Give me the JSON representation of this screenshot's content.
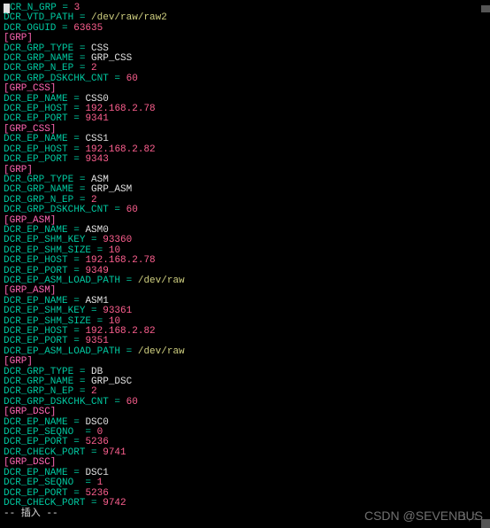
{
  "lines": [
    {
      "cursor": true,
      "key": "CR_N_GRP",
      "op": "=",
      "val": "3",
      "valClass": "num"
    },
    {
      "key": "DCR_VTD_PATH",
      "op": "=",
      "val": "/dev/raw/raw2",
      "valClass": "str-yellow"
    },
    {
      "key": "DCR_OGUID",
      "op": "=",
      "val": "63635",
      "valClass": "num"
    },
    {
      "section": "[GRP]"
    },
    {
      "key": "DCR_GRP_TYPE",
      "op": "=",
      "val": "CSS",
      "valClass": "val-white"
    },
    {
      "key": "DCR_GRP_NAME",
      "op": "=",
      "val": "GRP_CSS",
      "valClass": "val-white"
    },
    {
      "key": "DCR_GRP_N_EP",
      "op": "=",
      "val": "2",
      "valClass": "num"
    },
    {
      "key": "DCR_GRP_DSKCHK_CNT",
      "op": "=",
      "val": "60",
      "valClass": "num"
    },
    {
      "section": "[GRP_CSS]"
    },
    {
      "key": "DCR_EP_NAME",
      "op": "=",
      "val": "CSS0",
      "valClass": "val-white"
    },
    {
      "key": "DCR_EP_HOST",
      "op": "=",
      "val": "192.168.2.78",
      "valClass": "num"
    },
    {
      "key": "DCR_EP_PORT",
      "op": "=",
      "val": "9341",
      "valClass": "num"
    },
    {
      "section": "[GRP_CSS]"
    },
    {
      "key": "DCR_EP_NAME",
      "op": "=",
      "val": "CSS1",
      "valClass": "val-white"
    },
    {
      "key": "DCR_EP_HOST",
      "op": "=",
      "val": "192.168.2.82",
      "valClass": "num"
    },
    {
      "key": "DCR_EP_PORT",
      "op": "=",
      "val": "9343",
      "valClass": "num"
    },
    {
      "section": "[GRP]"
    },
    {
      "key": "DCR_GRP_TYPE",
      "op": "=",
      "val": "ASM",
      "valClass": "val-white"
    },
    {
      "key": "DCR_GRP_NAME",
      "op": "=",
      "val": "GRP_ASM",
      "valClass": "val-white"
    },
    {
      "key": "DCR_GRP_N_EP",
      "op": "=",
      "val": "2",
      "valClass": "num"
    },
    {
      "key": "DCR_GRP_DSKCHK_CNT",
      "op": "=",
      "val": "60",
      "valClass": "num"
    },
    {
      "section": "[GRP_ASM]"
    },
    {
      "key": "DCR_EP_NAME",
      "op": "=",
      "val": "ASM0",
      "valClass": "val-white"
    },
    {
      "key": "DCR_EP_SHM_KEY",
      "op": "=",
      "val": "93360",
      "valClass": "num"
    },
    {
      "key": "DCR_EP_SHM_SIZE",
      "op": "=",
      "val": "10",
      "valClass": "num"
    },
    {
      "key": "DCR_EP_HOST",
      "op": "=",
      "val": "192.168.2.78",
      "valClass": "num"
    },
    {
      "key": "DCR_EP_PORT",
      "op": "=",
      "val": "9349",
      "valClass": "num"
    },
    {
      "key": "DCR_EP_ASM_LOAD_PATH",
      "op": "=",
      "val": "/dev/raw",
      "valClass": "str-yellow"
    },
    {
      "section": "[GRP_ASM]"
    },
    {
      "key": "DCR_EP_NAME",
      "op": "=",
      "val": "ASM1",
      "valClass": "val-white"
    },
    {
      "key": "DCR_EP_SHM_KEY",
      "op": "=",
      "val": "93361",
      "valClass": "num"
    },
    {
      "key": "DCR_EP_SHM_SIZE",
      "op": "=",
      "val": "10",
      "valClass": "num"
    },
    {
      "key": "DCR_EP_HOST",
      "op": "=",
      "val": "192.168.2.82",
      "valClass": "num"
    },
    {
      "key": "DCR_EP_PORT",
      "op": "=",
      "val": "9351",
      "valClass": "num"
    },
    {
      "key": "DCR_EP_ASM_LOAD_PATH",
      "op": "=",
      "val": "/dev/raw",
      "valClass": "str-yellow"
    },
    {
      "section": "[GRP]"
    },
    {
      "key": "DCR_GRP_TYPE",
      "op": "=",
      "val": "DB",
      "valClass": "val-white"
    },
    {
      "key": "DCR_GRP_NAME",
      "op": "=",
      "val": "GRP_DSC",
      "valClass": "val-white"
    },
    {
      "key": "DCR_GRP_N_EP",
      "op": "=",
      "val": "2",
      "valClass": "num"
    },
    {
      "key": "DCR_GRP_DSKCHK_CNT",
      "op": "=",
      "val": "60",
      "valClass": "num"
    },
    {
      "section": "[GRP_DSC]"
    },
    {
      "key": "DCR_EP_NAME",
      "op": "=",
      "val": "DSC0",
      "valClass": "val-white"
    },
    {
      "key": "DCR_EP_SEQNO ",
      "op": "=",
      "val": "0",
      "valClass": "num"
    },
    {
      "key": "DCR_EP_PORT",
      "op": "=",
      "val": "5236",
      "valClass": "num"
    },
    {
      "key": "DCR_CHECK_PORT",
      "op": "=",
      "val": "9741",
      "valClass": "num"
    },
    {
      "section": "[GRP_DSC]"
    },
    {
      "key": "DCR_EP_NAME",
      "op": "=",
      "val": "DSC1",
      "valClass": "val-white"
    },
    {
      "key": "DCR_EP_SEQNO ",
      "op": "=",
      "val": "1",
      "valClass": "num"
    },
    {
      "key": "DCR_EP_PORT",
      "op": "=",
      "val": "5236",
      "valClass": "num"
    },
    {
      "key": "DCR_CHECK_PORT",
      "op": "=",
      "val": "9742",
      "valClass": "num"
    }
  ],
  "status": "-- 插入 --",
  "rowcol": "1,1",
  "watermark": "CSDN @SEVENBUS"
}
